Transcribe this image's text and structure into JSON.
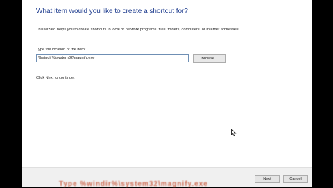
{
  "dialog": {
    "heading": "What item would you like to create a shortcut for?",
    "description": "This wizard helps you to create shortcuts to local or network programs, files, folders, computers, or Internet addresses.",
    "location_label": "Type the location of the item:",
    "location_value": "%windir%\\system32\\magnify.exe",
    "browse_label": "Browse...",
    "hint": "Click Next to continue."
  },
  "footer": {
    "next_label": "Next",
    "cancel_label": "Cancel"
  },
  "colors": {
    "heading": "#1f3d8f",
    "background": "#ffffff",
    "frame": "#000000"
  },
  "icons": [
    "mouse-pointer-icon"
  ]
}
